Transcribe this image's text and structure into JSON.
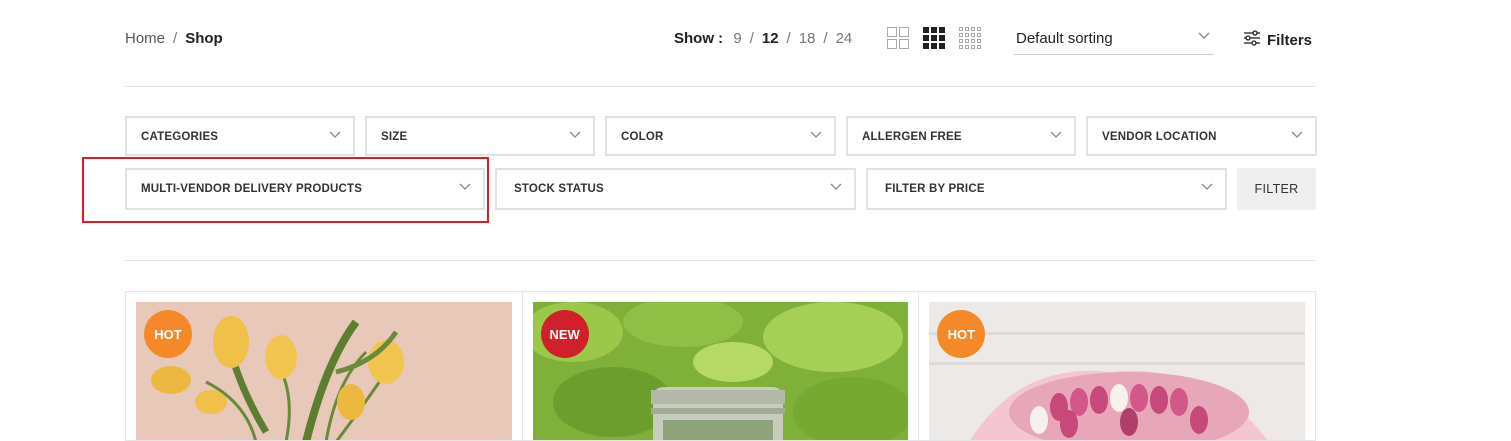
{
  "breadcrumb": {
    "home": "Home",
    "separator": "/",
    "current": "Shop"
  },
  "show": {
    "label": "Show :",
    "options": [
      "9",
      "12",
      "18",
      "24"
    ],
    "active": "12",
    "separator": "/"
  },
  "grid_views": [
    {
      "name": "grid-2-icon",
      "active": false
    },
    {
      "name": "grid-3-icon",
      "active": true
    },
    {
      "name": "grid-4-icon",
      "active": false
    }
  ],
  "sorting": {
    "value": "Default sorting",
    "icon": "chevron-down-icon"
  },
  "filters_button": {
    "label": "Filters",
    "icon": "sliders-icon"
  },
  "filters_row1": [
    "CATEGORIES",
    "SIZE",
    "COLOR",
    "ALLERGEN FREE",
    "VENDOR LOCATION"
  ],
  "filters_row2": [
    "MULTI-VENDOR DELIVERY PRODUCTS",
    "STOCK STATUS",
    "FILTER BY PRICE"
  ],
  "filter_button": {
    "label": "FILTER"
  },
  "highlight_color": "#e01b22",
  "products": [
    {
      "badge": "HOT",
      "badge_color": "#f5892a",
      "image": "yellow-tulips-image"
    },
    {
      "badge": "NEW",
      "badge_color": "#d0202a",
      "image": "herb-jar-image"
    },
    {
      "badge": "HOT",
      "badge_color": "#f5892a",
      "image": "pink-tulip-bouquet-image"
    }
  ]
}
